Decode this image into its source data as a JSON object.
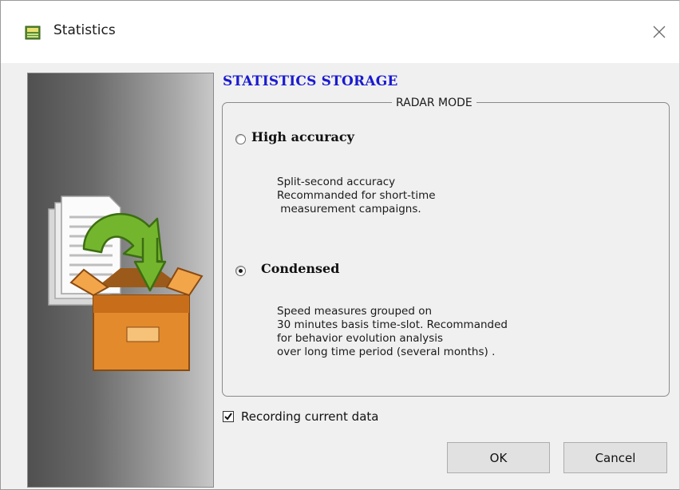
{
  "window": {
    "title": "Statistics",
    "app_icon": "statistics-app-icon",
    "close_icon": "close-icon"
  },
  "side_panel": {
    "image_icon": "documents-into-box-icon"
  },
  "section": {
    "title": "STATISTICS STORAGE"
  },
  "radar_mode": {
    "legend": "RADAR MODE",
    "selected": "Condensed",
    "options": [
      {
        "label": "High accuracy",
        "checked": false,
        "description": "Split-second accuracy\nRecommanded for short-time\n measurement campaigns."
      },
      {
        "label": "Condensed",
        "checked": true,
        "description": "Speed measures grouped on\n30 minutes basis time-slot. Recommanded\nfor behavior evolution analysis\nover long time period (several months) ."
      }
    ]
  },
  "recording": {
    "label": "Recording current data",
    "checked": true
  },
  "buttons": {
    "ok": "OK",
    "cancel": "Cancel"
  },
  "colors": {
    "section_title": "#1a1ad0",
    "dialog_background": "#f0f0f0",
    "button_background": "#e1e1e1",
    "box_orange": "#e08a2a",
    "arrow_green": "#6bb02a"
  }
}
